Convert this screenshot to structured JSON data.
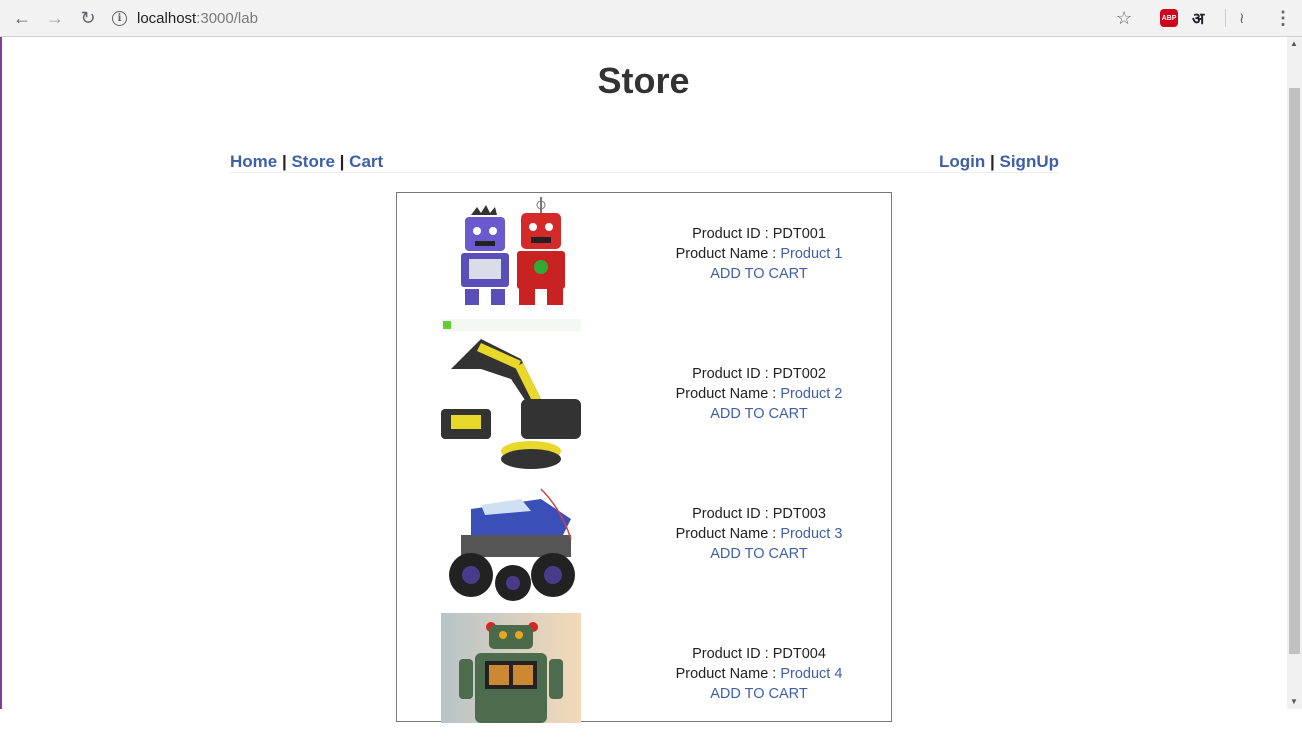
{
  "browser": {
    "url_host": "localhost",
    "url_path": ":3000/lab",
    "abp_label": "ABP",
    "lang_label": "अ",
    "info_label": "i"
  },
  "page": {
    "title": "Store"
  },
  "nav": {
    "home": "Home",
    "store": "Store",
    "cart": "Cart",
    "login": "Login",
    "signup": "SignUp",
    "sep": "|"
  },
  "products": [
    {
      "id_label": "Product ID : ",
      "id": "PDT001",
      "name_label": "Product Name : ",
      "name": "Product 1",
      "action": "ADD TO CART"
    },
    {
      "id_label": "Product ID : ",
      "id": "PDT002",
      "name_label": "Product Name : ",
      "name": "Product 2",
      "action": "ADD TO CART"
    },
    {
      "id_label": "Product ID : ",
      "id": "PDT003",
      "name_label": "Product Name : ",
      "name": "Product 3",
      "action": "ADD TO CART"
    },
    {
      "id_label": "Product ID : ",
      "id": "PDT004",
      "name_label": "Product Name : ",
      "name": "Product 4",
      "action": "ADD TO CART"
    }
  ],
  "colors": {
    "link": "#3f5fa8",
    "text": "#222222"
  }
}
